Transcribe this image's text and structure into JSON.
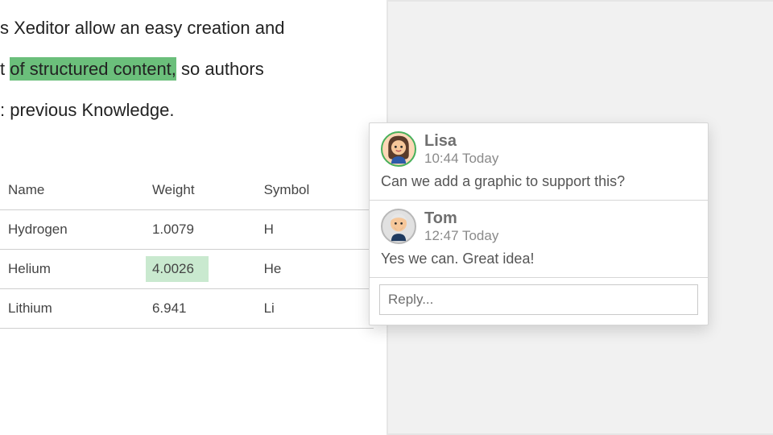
{
  "doc": {
    "line1_prefix": "s Xeditor allow an easy creation and",
    "line2_prefix": "t ",
    "line2_highlight": "of structured content,",
    "line2_suffix": " so authors",
    "line3": ": previous Knowledge."
  },
  "table": {
    "headers": [
      "Name",
      "Weight",
      "Symbol"
    ],
    "rows": [
      {
        "name": "Hydrogen",
        "weight": "1.0079",
        "symbol": "H",
        "weight_highlight": false
      },
      {
        "name": "Helium",
        "weight": "4.0026",
        "symbol": "He",
        "weight_highlight": true
      },
      {
        "name": "Lithium",
        "weight": "6.941",
        "symbol": "Li",
        "weight_highlight": false
      }
    ]
  },
  "comments": [
    {
      "author": "Lisa",
      "time": "10:44 Today",
      "body": "Can we add a graphic to support this?",
      "avatar": "lisa"
    },
    {
      "author": "Tom",
      "time": "12:47 Today",
      "body": "Yes we can. Great idea!",
      "avatar": "tom"
    }
  ],
  "reply_placeholder": "Reply..."
}
